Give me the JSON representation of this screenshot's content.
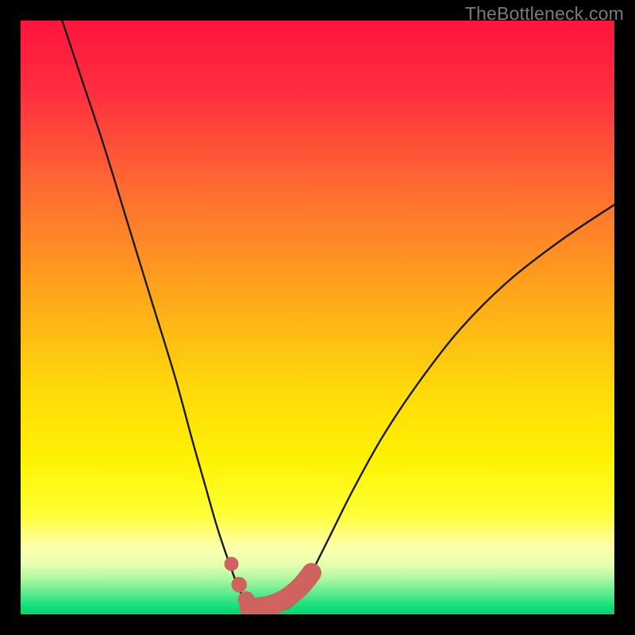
{
  "watermark": "TheBottleneck.com",
  "colors": {
    "frame": "#000000",
    "curve": "#1a1a1a",
    "bumps": "#cf615f",
    "gradient_stops": [
      {
        "offset": 0.0,
        "color": "#ff153d"
      },
      {
        "offset": 0.12,
        "color": "#ff2e3f"
      },
      {
        "offset": 0.28,
        "color": "#ff6a32"
      },
      {
        "offset": 0.45,
        "color": "#ffa31c"
      },
      {
        "offset": 0.62,
        "color": "#ffd90a"
      },
      {
        "offset": 0.74,
        "color": "#fff203"
      },
      {
        "offset": 0.83,
        "color": "#ffff33"
      },
      {
        "offset": 0.885,
        "color": "#ffffaa"
      },
      {
        "offset": 0.915,
        "color": "#e8ffb0"
      },
      {
        "offset": 0.94,
        "color": "#aef7a1"
      },
      {
        "offset": 0.965,
        "color": "#5bea8d"
      },
      {
        "offset": 0.985,
        "color": "#17e07c"
      },
      {
        "offset": 1.0,
        "color": "#04d46b"
      }
    ]
  },
  "chart_data": {
    "type": "line",
    "title": "",
    "xlabel": "",
    "ylabel": "",
    "xlim": [
      0,
      100
    ],
    "ylim": [
      0,
      100
    ],
    "note": "V-shaped bottleneck curve. y=100 at frame top, y≈0 (optimal/green zone) at the dip. Two asymmetric arms meeting in a short flat valley around x≈38–48.",
    "series": [
      {
        "name": "bottleneck-curve",
        "x": [
          7,
          10,
          14,
          18,
          22,
          26,
          29,
          31,
          33,
          35,
          36.5,
          38,
          40,
          42,
          44,
          46,
          47.5,
          49,
          52,
          56,
          61,
          67,
          74,
          82,
          91,
          100
        ],
        "y": [
          100,
          91,
          79,
          66,
          53,
          40,
          29,
          22,
          15,
          9,
          5,
          2,
          0.8,
          0.5,
          0.7,
          1.8,
          4,
          7,
          13,
          21,
          30,
          39,
          48,
          56,
          63,
          69
        ]
      }
    ],
    "bumps": {
      "note": "Salmon colored markers along the valley floor — a few large dots and a thick sausage-like segment on the rising side.",
      "points": [
        {
          "x": 35.5,
          "y": 8.5,
          "r": 1.2
        },
        {
          "x": 36.8,
          "y": 5.0,
          "r": 1.3
        },
        {
          "x": 38.0,
          "y": 2.5,
          "r": 1.4
        }
      ],
      "sausage": {
        "x0": 38.5,
        "y0": 1.2,
        "x1": 49.0,
        "y1": 7.0,
        "width": 3.3
      }
    }
  }
}
